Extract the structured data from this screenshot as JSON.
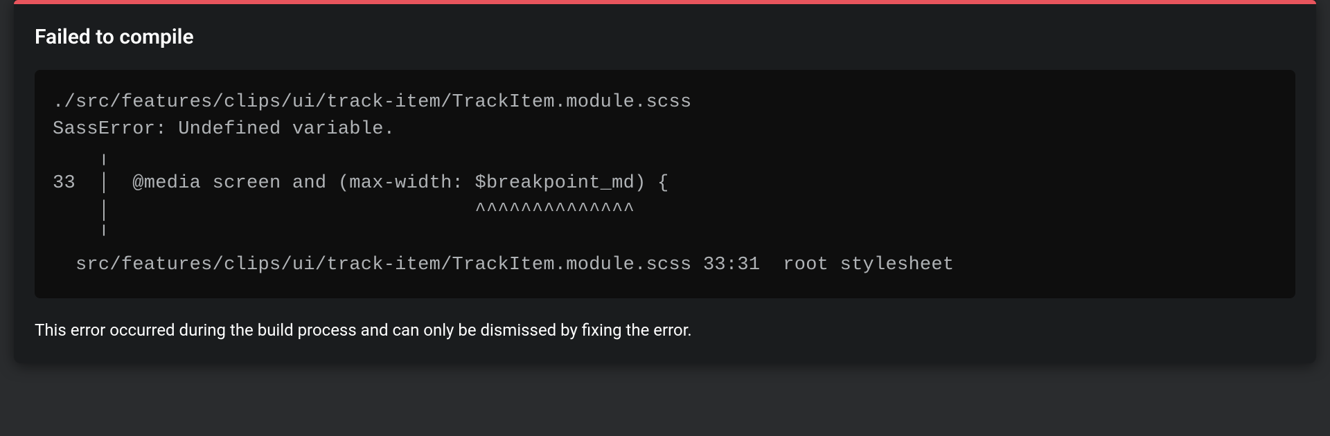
{
  "error": {
    "title": "Failed to compile",
    "code": "./src/features/clips/ui/track-item/TrackItem.module.scss\nSassError: Undefined variable.\n    ╷\n33  │  @media screen and (max-width: $breakpoint_md) {\n    │                                ^^^^^^^^^^^^^^\n    ╵\n  src/features/clips/ui/track-item/TrackItem.module.scss 33:31  root stylesheet",
    "footer": "This error occurred during the build process and can only be dismissed by fixing the error."
  }
}
